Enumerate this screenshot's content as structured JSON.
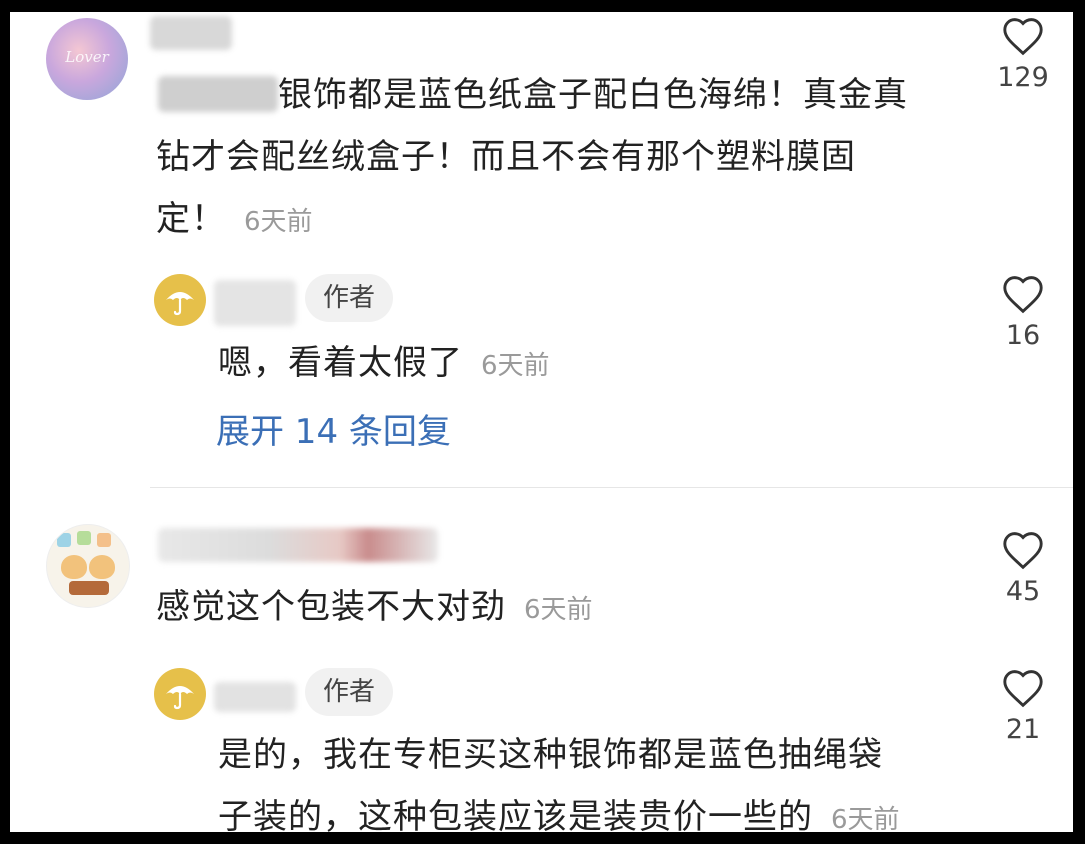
{
  "comments": [
    {
      "text": "银饰都是蓝色纸盒子配白色海绵！真金真钻才会配丝绒盒子！而且不会有那个塑料膜固定！",
      "line1": "银饰都是蓝色纸盒子配白色海绵！真金真",
      "line2": "钻才会配丝绒盒子！而且不会有那个塑料膜固",
      "line3": "定！",
      "avatar_text": "Lover",
      "time": "6天前",
      "likes": "129",
      "reply": {
        "badge": "作者",
        "text": "嗯，看着太假了",
        "time": "6天前",
        "likes": "16"
      },
      "expand_label": "展开 14 条回复"
    },
    {
      "text": "感觉这个包装不大对劲",
      "time": "6天前",
      "likes": "45",
      "reply": {
        "badge": "作者",
        "line1": "是的，我在专柜买这种银饰都是蓝色抽绳袋",
        "line2": "子装的，这种包装应该是装贵价一些的",
        "time": "6天前",
        "likes": "21"
      }
    }
  ],
  "colors": {
    "text": "#222222",
    "time": "#9a9a9a",
    "link": "#3b6fb6",
    "badge_bg": "#f1f1f1",
    "umbrella_avatar": "#e6c04a"
  },
  "icons": [
    "heart-outline-icon",
    "umbrella-icon"
  ]
}
